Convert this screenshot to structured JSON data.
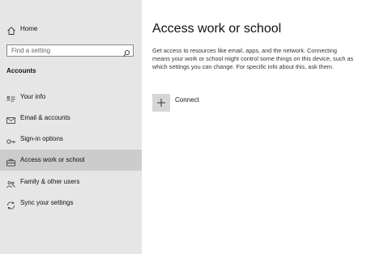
{
  "sidebar": {
    "home_label": "Home",
    "search_placeholder": "Find a setting",
    "section_title": "Accounts",
    "items": [
      {
        "label": "Your info",
        "icon": "person-card-icon"
      },
      {
        "label": "Email & accounts",
        "icon": "mail-icon"
      },
      {
        "label": "Sign-in options",
        "icon": "key-icon"
      },
      {
        "label": "Access work or school",
        "icon": "briefcase-icon",
        "active": true
      },
      {
        "label": "Family & other users",
        "icon": "people-icon"
      },
      {
        "label": "Sync your settings",
        "icon": "sync-icon"
      }
    ]
  },
  "main": {
    "title": "Access work or school",
    "description": "Get access to resources like email, apps, and the network. Connecting means your work or school might control some things on this device, such as which settings you can change. For specific info about this, ask them.",
    "connect_label": "Connect"
  },
  "colors": {
    "sidebar_bg": "#e6e6e6",
    "active_item_bg": "#cccccc",
    "tile_bg": "#d6d6d6"
  }
}
